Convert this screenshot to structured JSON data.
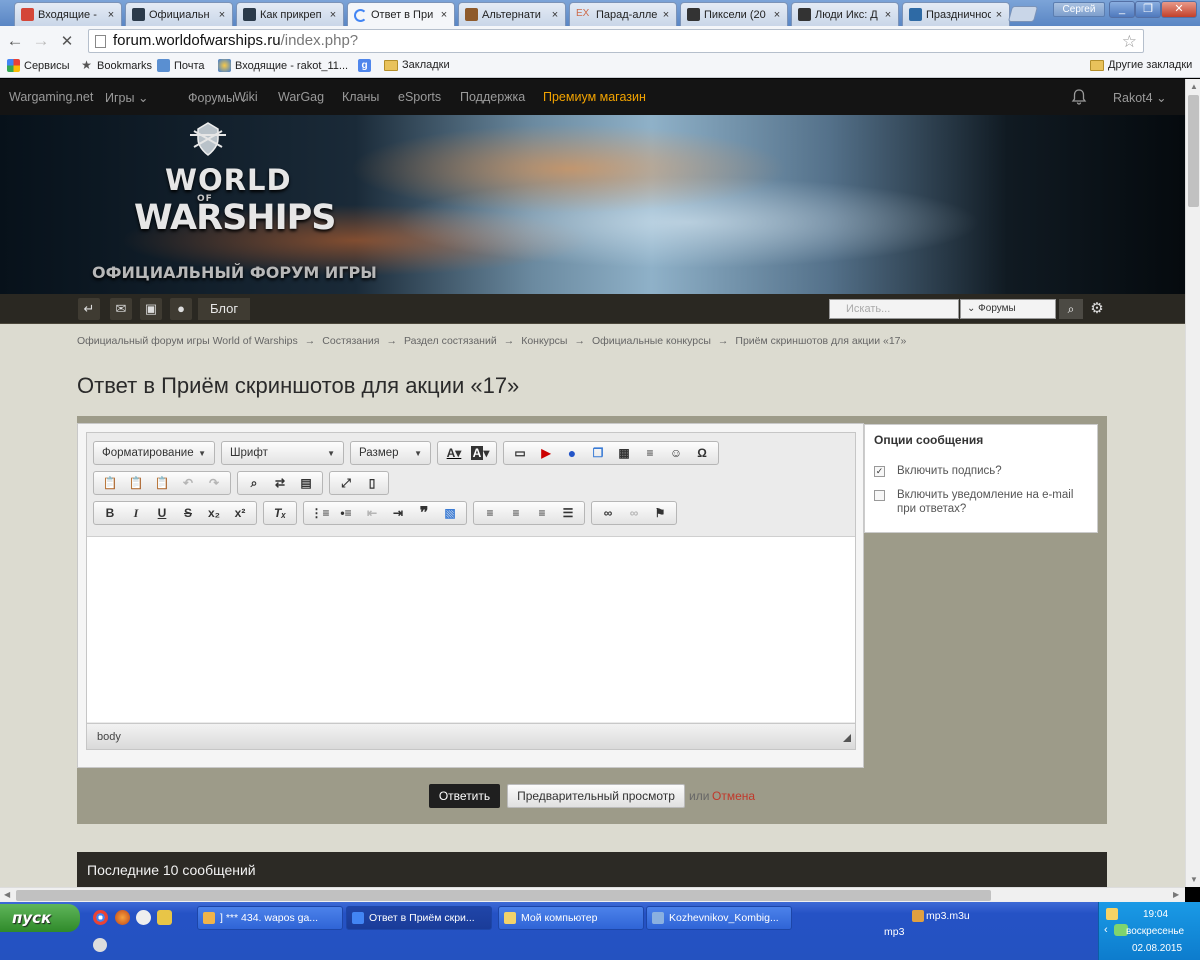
{
  "browser": {
    "tabs": [
      {
        "label": "Входящие -",
        "icon_color": "#d44638"
      },
      {
        "label": "Официальн",
        "icon_color": "#2b3a4a"
      },
      {
        "label": "Как прикреп",
        "icon_color": "#2b3a4a"
      },
      {
        "label": "Ответ в При",
        "icon_color": "#4285f4",
        "active": true
      },
      {
        "label": "Альтернати",
        "icon_color": "#8e5a2b"
      },
      {
        "label": "Парад-алле",
        "icon_color": "#cc6b4b",
        "prefix": "EX"
      },
      {
        "label": "Пиксели (20",
        "icon_color": "#333333"
      },
      {
        "label": "Люди Икс: Д",
        "icon_color": "#333333"
      },
      {
        "label": "Праздничнос",
        "icon_color": "#2e6aa5"
      }
    ],
    "tab_close": "×",
    "user_badge": "Сергей",
    "window_buttons": {
      "minimize": "_",
      "maximize": "❐",
      "close": "✕"
    },
    "url_domain": "forum.worldofwarships.ru",
    "url_path": "/index.php?",
    "bookmarks": [
      {
        "label": "Сервисы",
        "icon": "apps-icon"
      },
      {
        "label": "Bookmarks",
        "icon": "star-icon"
      },
      {
        "label": "Почта",
        "icon": "mail-icon"
      },
      {
        "label": "Входящие - rakot_11...",
        "icon": "inbox-icon"
      },
      {
        "label": "",
        "icon": "google-icon"
      },
      {
        "label": "Закладки",
        "icon": "folder-icon"
      }
    ],
    "other_bookmarks": "Другие закладки"
  },
  "site": {
    "nav": [
      {
        "label": "Wargaming.net"
      },
      {
        "label": "Игры ⌄"
      },
      {
        "label": "Форумы ⌄"
      },
      {
        "label": "Wiki"
      },
      {
        "label": "WarGag"
      },
      {
        "label": "Кланы"
      },
      {
        "label": "eSports"
      },
      {
        "label": "Поддержка"
      },
      {
        "label": "Премиум магазин",
        "premium": true
      }
    ],
    "user": "Rakot4 ⌄",
    "logo_world": "WORLD",
    "logo_of": "OF",
    "logo_warships": "WARSHIPS",
    "banner_caption": "ОФИЦИАЛЬНЫЙ ФОРУМ ИГРЫ",
    "blog": "Блог",
    "search_placeholder": "Искать...",
    "search_scope": "⌄ Форумы",
    "breadcrumbs": [
      "Официальный форум игры World of Warships",
      "Состязания",
      "Раздел состязаний",
      "Конкурсы",
      "Официальные конкурсы",
      "Приём скриншотов для акции «17»"
    ],
    "crumb_sep": "→",
    "page_title": "Ответ в Приём скриншотов для акции «17»",
    "editor": {
      "format_combo": "Форматирование",
      "font_combo": "Шрифт",
      "size_combo": "Размер",
      "status_path": "body"
    },
    "options": {
      "title": "Опции сообщения",
      "items": [
        {
          "label": "Включить подпись?",
          "checked": true
        },
        {
          "label": "Включить уведомление на e-mail при ответах?",
          "checked": false
        }
      ]
    },
    "reply_button": "Ответить",
    "preview_button": "Предварительный просмотр",
    "or_text": "или",
    "cancel_link": "Отмена",
    "recent_title": "Последние 10 сообщений"
  },
  "taskbar": {
    "start": "пуск",
    "tasks": [
      {
        "label": "] *** 434. wapos ga...",
        "icon_color": "#f0b44a"
      },
      {
        "label": "Ответ в Приём скри...",
        "icon_color": "#4285f4",
        "active": true
      },
      {
        "label": "Мой компьютер",
        "icon_color": "#f1d36b"
      },
      {
        "label": "Kozhevnikov_Kombig...",
        "icon_color": "#8ab0e0"
      }
    ],
    "tray_file": "mp3.m3u",
    "tray_sub": "mp3",
    "time": "19:04",
    "day": "воскресенье",
    "date": "02.08.2015"
  }
}
